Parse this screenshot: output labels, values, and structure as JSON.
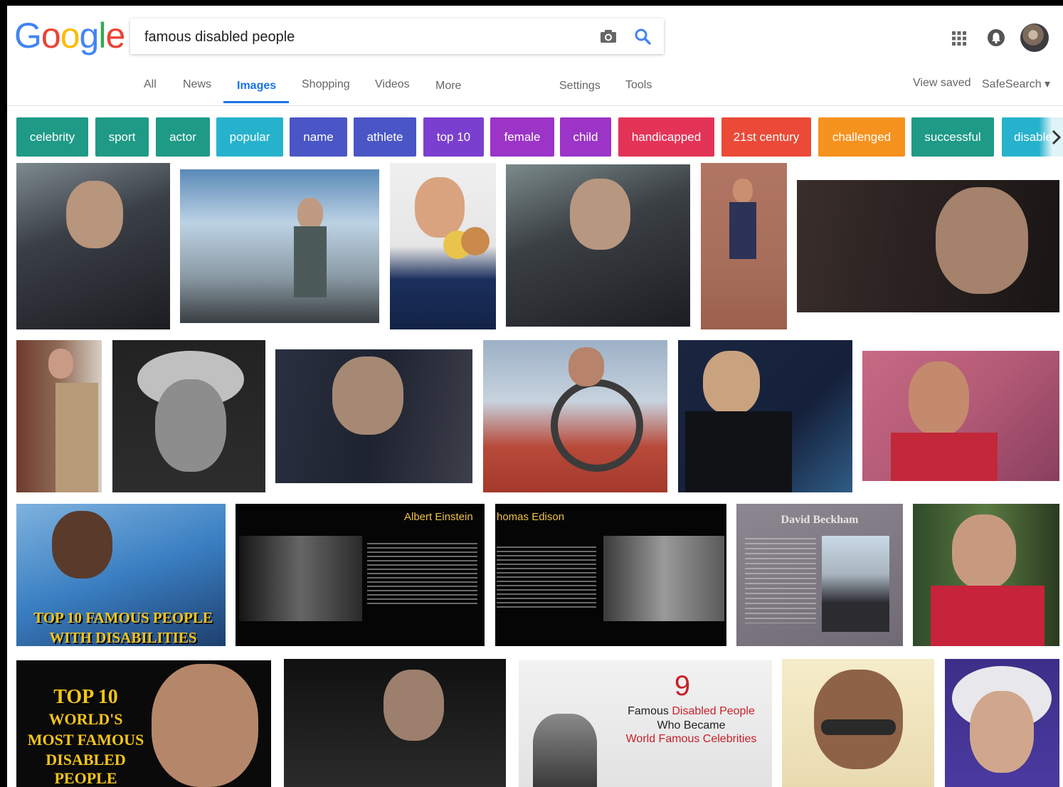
{
  "search": {
    "query": "famous disabled people"
  },
  "logo": {
    "letters": [
      "G",
      "o",
      "o",
      "g",
      "l",
      "e"
    ]
  },
  "nav": {
    "tabs": [
      "All",
      "News",
      "Images",
      "Shopping",
      "Videos",
      "More"
    ],
    "settings": "Settings",
    "tools": "Tools",
    "view_saved": "View saved",
    "safesearch": "SafeSearch ▾"
  },
  "chips": [
    {
      "label": "celebrity",
      "color": "#1e9a86"
    },
    {
      "label": "sport",
      "color": "#1e9a86"
    },
    {
      "label": "actor",
      "color": "#1e9a86"
    },
    {
      "label": "popular",
      "color": "#26b2cc"
    },
    {
      "label": "name",
      "color": "#4a56c6"
    },
    {
      "label": "athlete",
      "color": "#4a56c6"
    },
    {
      "label": "top 10",
      "color": "#7b3fcf"
    },
    {
      "label": "female",
      "color": "#9b34c7"
    },
    {
      "label": "child",
      "color": "#9b34c7"
    },
    {
      "label": "handicapped",
      "color": "#e33457"
    },
    {
      "label": "21st century",
      "color": "#ea4a37"
    },
    {
      "label": "challenged",
      "color": "#f6921e"
    },
    {
      "label": "successful",
      "color": "#1e9a86"
    },
    {
      "label": "disable",
      "color": "#26b2cc"
    }
  ],
  "overlays": {
    "top10_left_line1": "TOP 10 FAMOUS PEOPLE",
    "top10_left_line2": "WITH DISABILITIES",
    "einstein_title": "Albert Einstein",
    "edison_title": "homas Edison",
    "beckham_title": "David Beckham",
    "top10_world": [
      "TOP 10",
      "WORLD'S",
      "MOST FAMOUS",
      "DISABLED PEOPLE"
    ],
    "nine": "9",
    "nine_line1_a": "Famous ",
    "nine_line1_b": "Disabled People",
    "nine_line2": "Who Became",
    "nine_line3": "World Famous Celebrities"
  }
}
